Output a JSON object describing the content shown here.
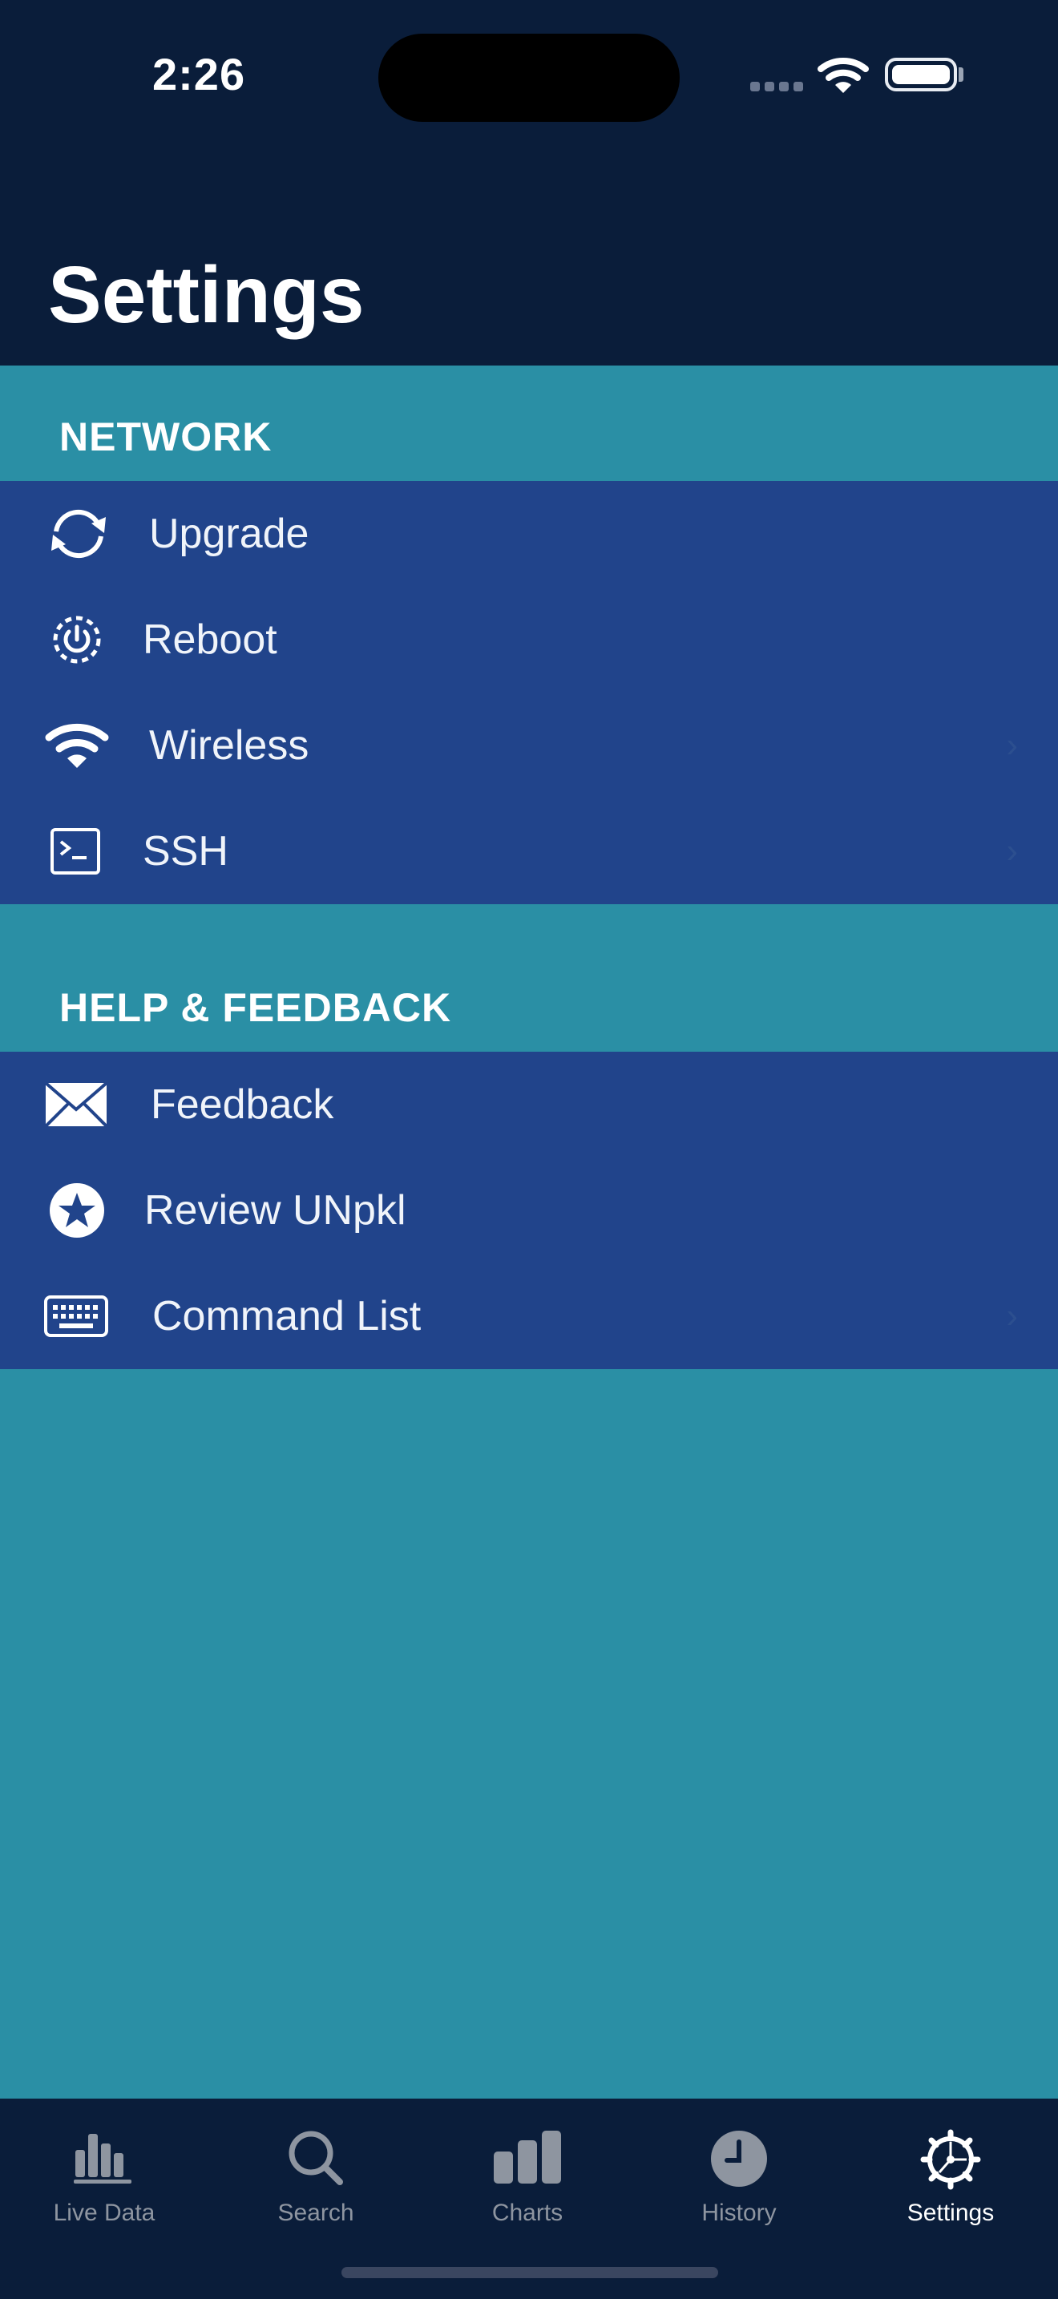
{
  "status_bar": {
    "time": "2:26"
  },
  "page_title": "Settings",
  "sections": [
    {
      "header": "NETWORK",
      "items": [
        {
          "label": "Upgrade",
          "icon": "refresh-icon",
          "chevron": false
        },
        {
          "label": "Reboot",
          "icon": "power-icon",
          "chevron": false
        },
        {
          "label": "Wireless",
          "icon": "wifi-icon",
          "chevron": true
        },
        {
          "label": "SSH",
          "icon": "terminal-icon",
          "chevron": true
        }
      ]
    },
    {
      "header": "HELP & FEEDBACK",
      "items": [
        {
          "label": "Feedback",
          "icon": "envelope-icon",
          "chevron": false
        },
        {
          "label": "Review UNpkl",
          "icon": "star-icon",
          "chevron": false
        },
        {
          "label": "Command List",
          "icon": "keyboard-icon",
          "chevron": true
        }
      ]
    }
  ],
  "tab_bar": {
    "tabs": [
      {
        "label": "Live Data",
        "icon": "bar-chart-icon",
        "active": false
      },
      {
        "label": "Search",
        "icon": "search-icon",
        "active": false
      },
      {
        "label": "Charts",
        "icon": "chart-icon",
        "active": false
      },
      {
        "label": "History",
        "icon": "clock-icon",
        "active": false
      },
      {
        "label": "Settings",
        "icon": "gear-icon",
        "active": true
      }
    ]
  },
  "colors": {
    "header_bg": "#0a1d3a",
    "section_bg": "#2a8fa5",
    "row_bg": "#21448b",
    "active_tab": "#ffffff",
    "inactive_tab": "#8e95a0"
  }
}
